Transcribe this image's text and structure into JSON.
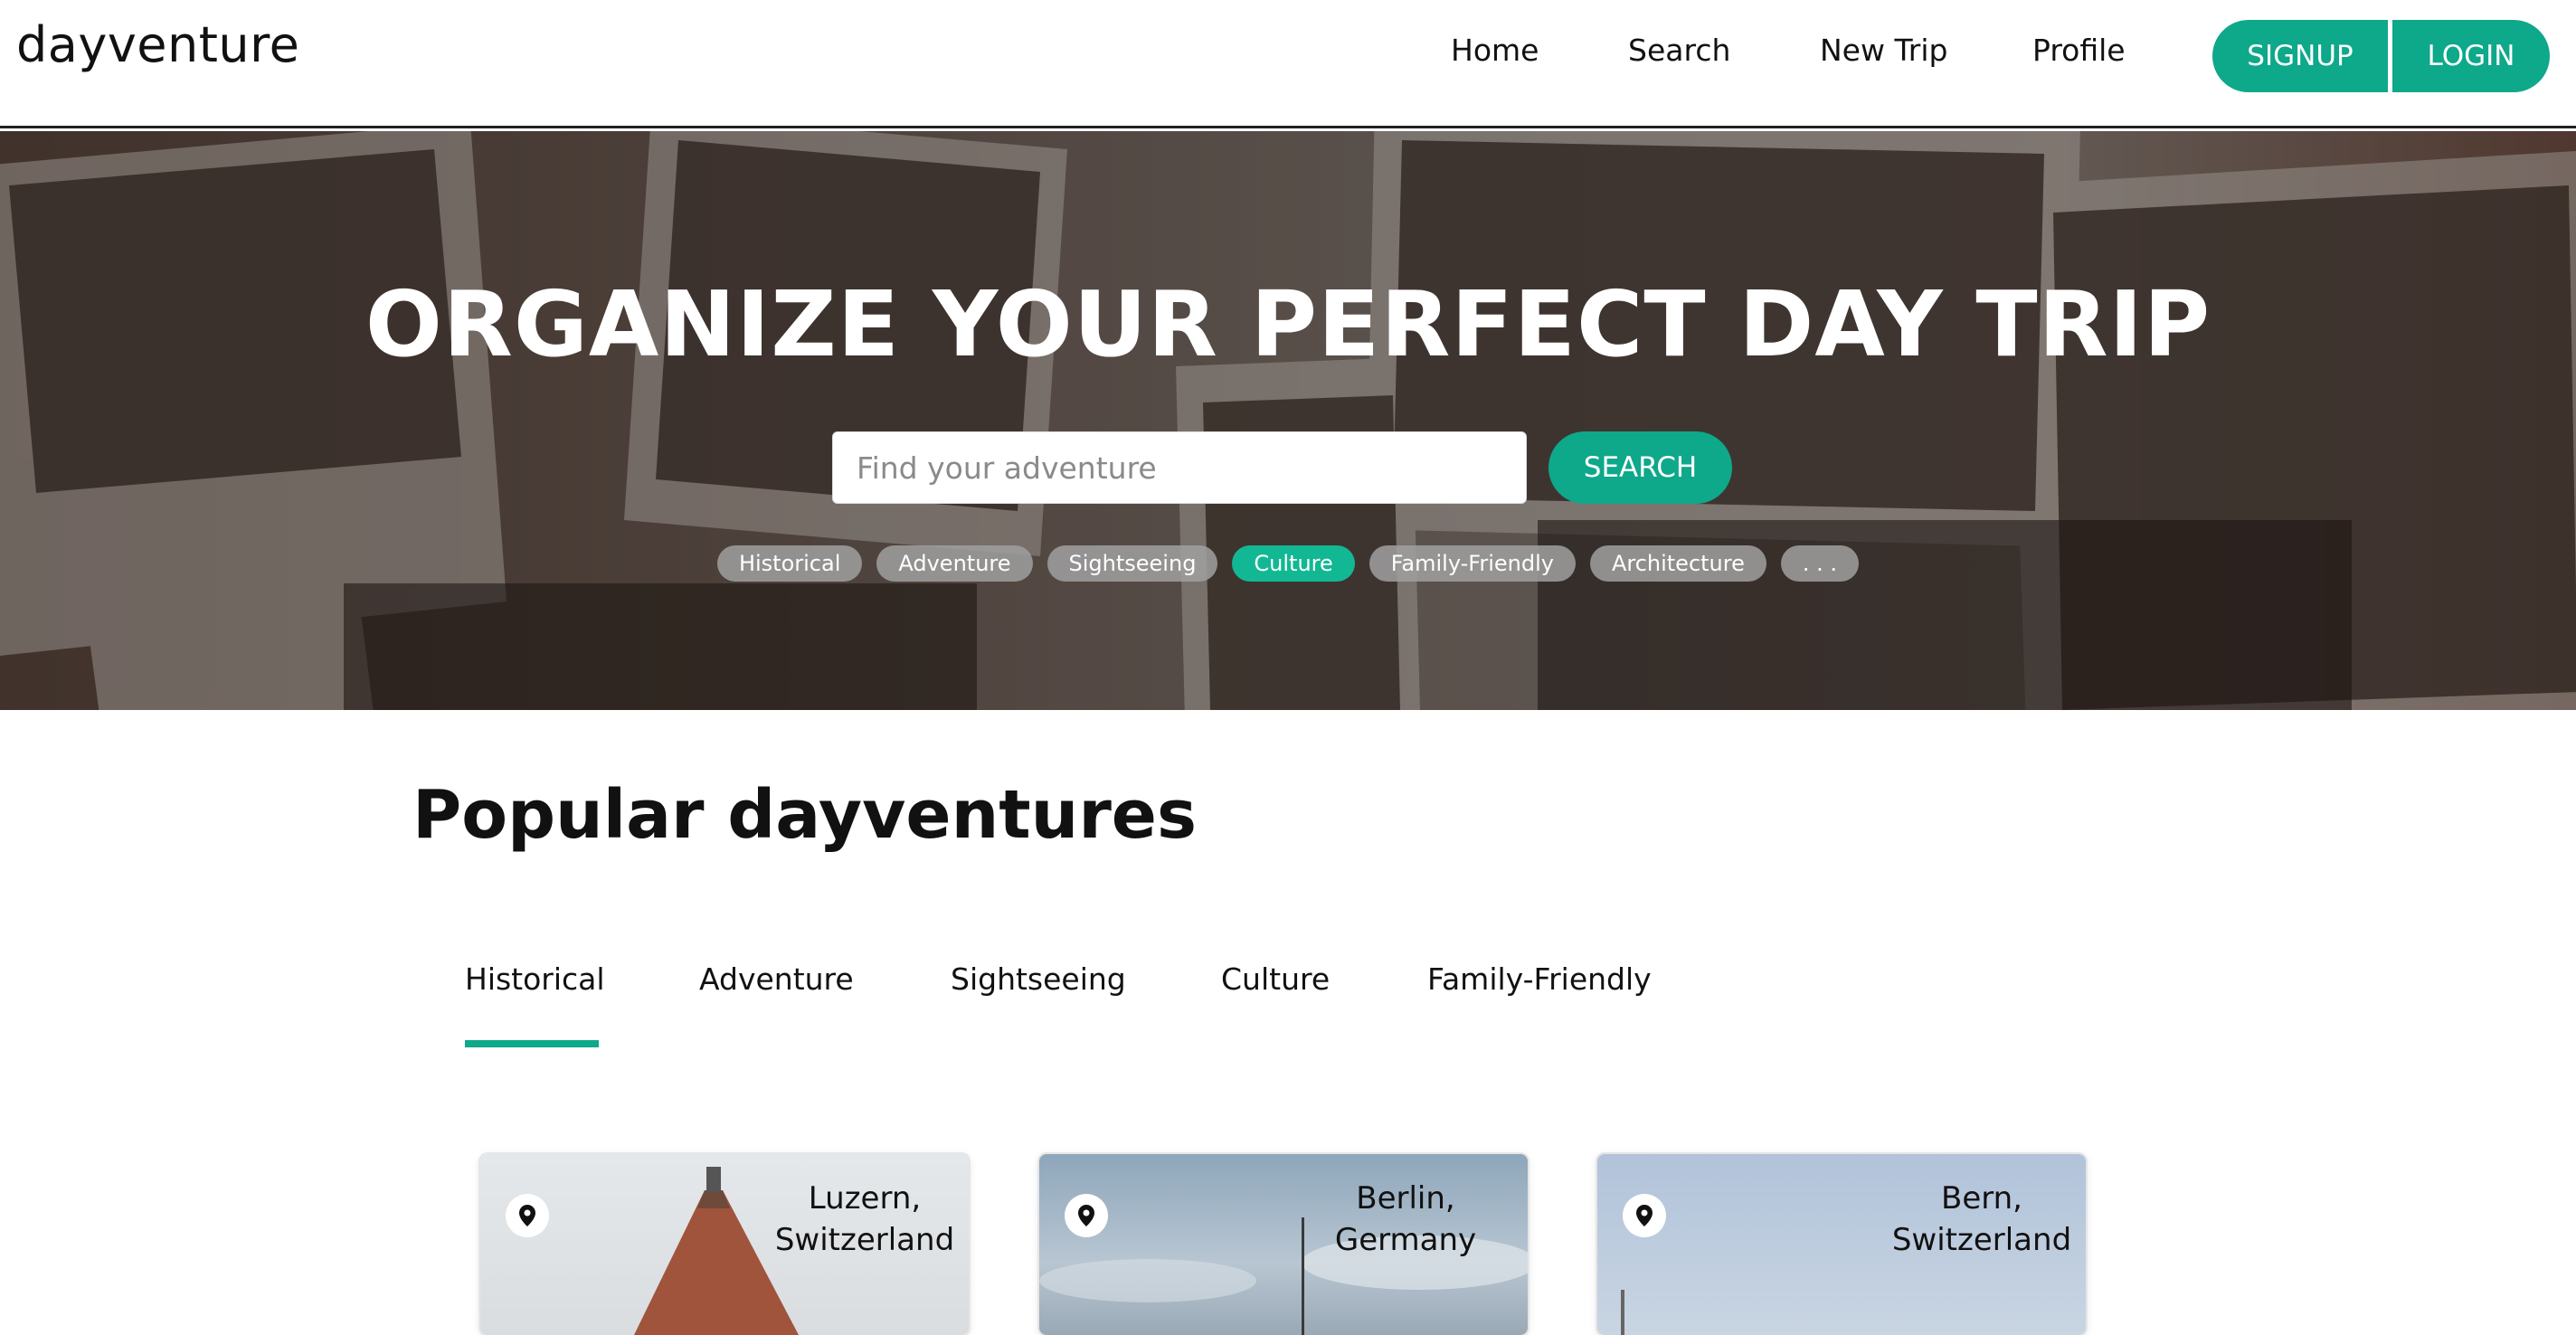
{
  "app": {
    "logo": "dayventure"
  },
  "nav": {
    "links": [
      "Home",
      "Search",
      "New Trip",
      "Profile"
    ],
    "signup_label": "SIGNUP",
    "login_label": "LOGIN"
  },
  "hero": {
    "title": "ORGANIZE YOUR PERFECT DAY TRIP",
    "search_placeholder": "Find your adventure",
    "search_value": "",
    "search_button": "SEARCH",
    "chips": [
      {
        "label": "Historical",
        "active": false
      },
      {
        "label": "Adventure",
        "active": false
      },
      {
        "label": "Sightseeing",
        "active": false
      },
      {
        "label": "Culture",
        "active": true
      },
      {
        "label": "Family-Friendly",
        "active": false
      },
      {
        "label": "Architecture",
        "active": false
      },
      {
        "label": ". . .",
        "active": false
      }
    ]
  },
  "popular": {
    "title": "Popular dayventures",
    "tabs": [
      "Historical",
      "Adventure",
      "Sightseeing",
      "Culture",
      "Family-Friendly"
    ],
    "selected_tab": "Historical",
    "cards": [
      {
        "location_line1": "Luzern,",
        "location_line2": "Switzerland",
        "icon": "map-pin-icon"
      },
      {
        "location_line1": "Berlin, Germany",
        "location_line2": "",
        "icon": "map-pin-icon"
      },
      {
        "location_line1": "Bern,",
        "location_line2": "Switzerland",
        "icon": "map-pin-icon"
      }
    ]
  },
  "colors": {
    "accent": "#0ea88a",
    "chip_active": "#12b893",
    "chip_inactive": "#a0a0a0"
  }
}
